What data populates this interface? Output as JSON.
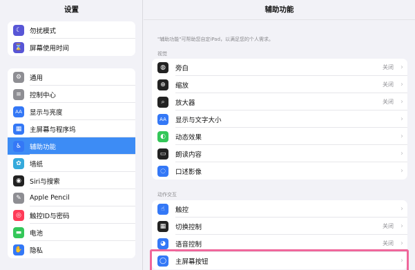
{
  "sidebar": {
    "title": "设置",
    "group1": [
      {
        "label": "勿扰模式",
        "icon": "moon-icon",
        "color": "#5856d6",
        "glyph": "☾"
      },
      {
        "label": "屏幕使用时间",
        "icon": "hourglass-icon",
        "color": "#5856d6",
        "glyph": "⌛"
      }
    ],
    "group2": [
      {
        "label": "通用",
        "icon": "gear-icon",
        "color": "#8e8e93",
        "glyph": "⚙"
      },
      {
        "label": "控制中心",
        "icon": "toggles-icon",
        "color": "#8e8e93",
        "glyph": "≡"
      },
      {
        "label": "显示与亮度",
        "icon": "text-size-icon",
        "color": "#3478f6",
        "glyph": "AA"
      },
      {
        "label": "主屏幕与程序坞",
        "icon": "home-grid-icon",
        "color": "#3478f6",
        "glyph": "▦"
      },
      {
        "label": "辅助功能",
        "icon": "accessibility-icon",
        "color": "#3478f6",
        "glyph": "♿",
        "active": true
      },
      {
        "label": "墙纸",
        "icon": "flower-icon",
        "color": "#35aadc",
        "glyph": "✿"
      },
      {
        "label": "Siri与搜索",
        "icon": "siri-icon",
        "color": "#222222",
        "glyph": "◉"
      },
      {
        "label": "Apple Pencil",
        "icon": "pencil-icon",
        "color": "#8e8e93",
        "glyph": "✎"
      },
      {
        "label": "触控ID与密码",
        "icon": "fingerprint-icon",
        "color": "#ff3b58",
        "glyph": "◎"
      },
      {
        "label": "电池",
        "icon": "battery-icon",
        "color": "#34c759",
        "glyph": "▬"
      },
      {
        "label": "隐私",
        "icon": "hand-icon",
        "color": "#3478f6",
        "glyph": "✋"
      }
    ]
  },
  "main": {
    "title": "辅助功能",
    "description": "\"辅助功能\"可帮助您自定iPad，以满足您的个人需求。",
    "vision": {
      "label": "视觉",
      "rows": [
        {
          "label": "旁白",
          "value": "关闭",
          "icon": "voiceover-icon",
          "color": "#222222",
          "glyph": "◍"
        },
        {
          "label": "缩放",
          "value": "关闭",
          "icon": "zoom-icon",
          "color": "#222222",
          "glyph": "⊕"
        },
        {
          "label": "放大器",
          "value": "关闭",
          "icon": "magnifier-icon",
          "color": "#222222",
          "glyph": "⌕"
        },
        {
          "label": "显示与文字大小",
          "value": "",
          "icon": "text-size-icon",
          "color": "#3478f6",
          "glyph": "AA"
        },
        {
          "label": "动态效果",
          "value": "",
          "icon": "motion-icon",
          "color": "#34c759",
          "glyph": "◐"
        },
        {
          "label": "朗读内容",
          "value": "",
          "icon": "speech-bubble-icon",
          "color": "#222222",
          "glyph": "▭"
        },
        {
          "label": "口述影像",
          "value": "",
          "icon": "audio-description-icon",
          "color": "#3478f6",
          "glyph": "◌"
        }
      ]
    },
    "interaction": {
      "label": "动作交互",
      "rows": [
        {
          "label": "触控",
          "value": "",
          "icon": "touch-icon",
          "color": "#3478f6",
          "glyph": "☝"
        },
        {
          "label": "切换控制",
          "value": "关闭",
          "icon": "switch-control-icon",
          "color": "#222222",
          "glyph": "▦"
        },
        {
          "label": "语音控制",
          "value": "关闭",
          "icon": "voice-control-icon",
          "color": "#3478f6",
          "glyph": "◕"
        },
        {
          "label": "主屏幕按钮",
          "value": "",
          "icon": "home-button-icon",
          "color": "#3478f6",
          "glyph": "◯"
        }
      ]
    },
    "chevron": "›"
  }
}
